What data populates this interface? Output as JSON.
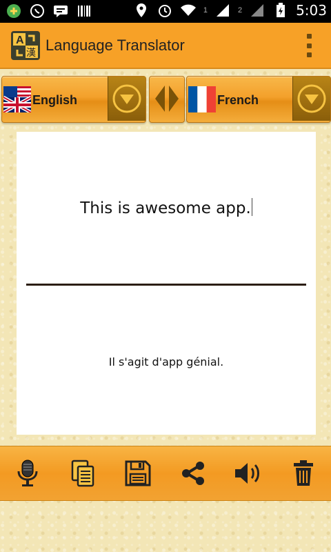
{
  "status_bar": {
    "time": "5:03",
    "signal_sim1": "1",
    "signal_sim2": "2",
    "icons": [
      "app-icon",
      "whatsapp-icon",
      "message-icon",
      "barcode-icon",
      "location-icon",
      "alarm-icon",
      "wifi-icon",
      "signal-icon",
      "battery-icon"
    ]
  },
  "app_bar": {
    "title": "Language Translator",
    "logo_letters": "A",
    "logo_glyph": "漢"
  },
  "languages": {
    "source": "English",
    "target": "French"
  },
  "translation": {
    "source_text": "This is awesome app.",
    "target_text": "Il s'agit d'app génial."
  },
  "toolbar": {
    "icons": [
      "microphone-icon",
      "copy-icon",
      "save-icon",
      "share-icon",
      "speaker-icon",
      "trash-icon"
    ]
  },
  "colors": {
    "accent": "#f7a127",
    "button_dark": "#8a5e0a",
    "background": "#f3e6b6"
  }
}
